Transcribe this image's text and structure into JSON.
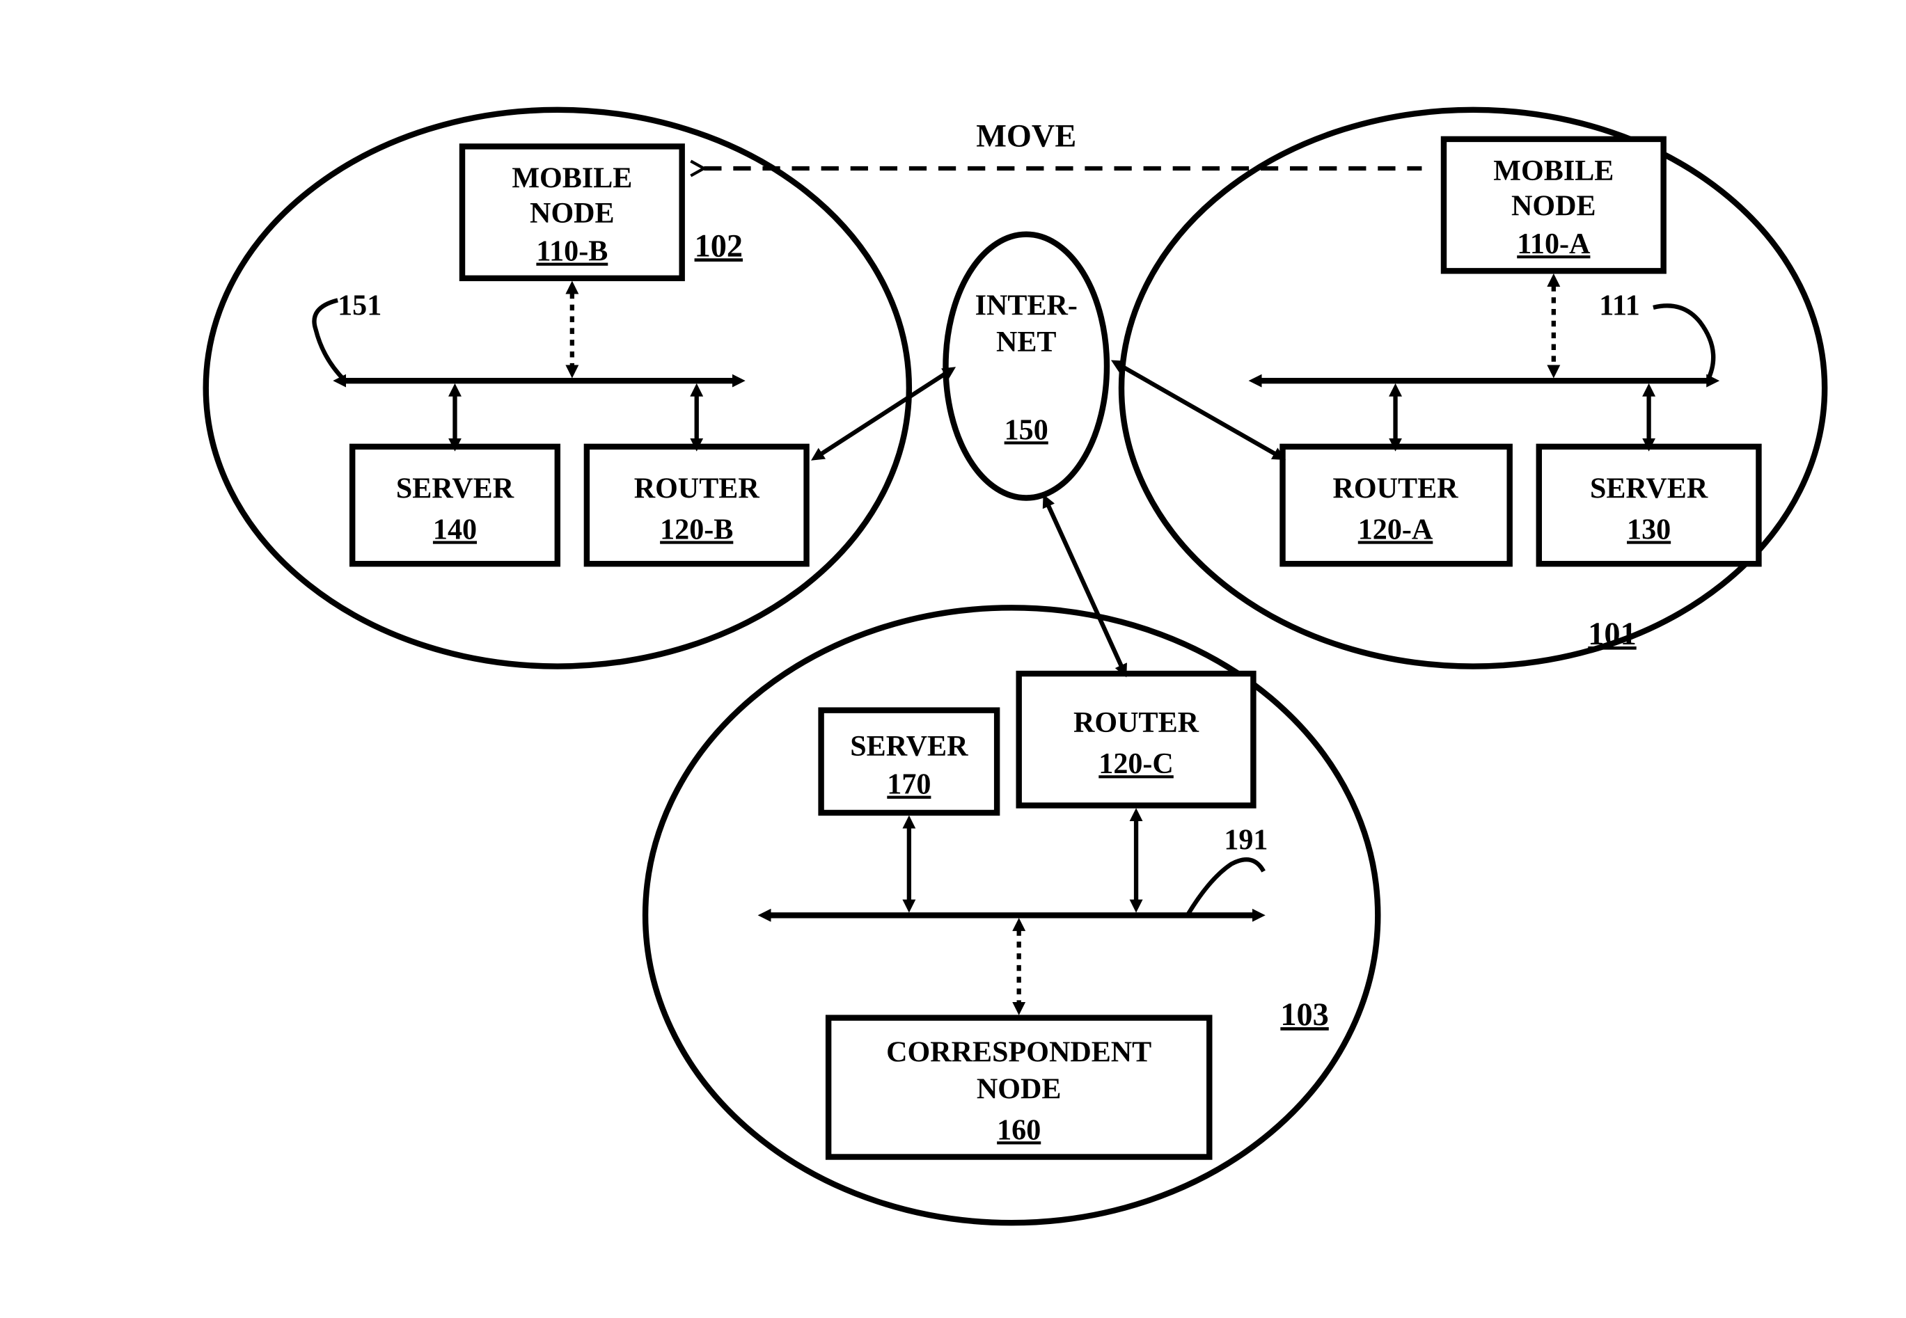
{
  "diagram": {
    "move_label": "MOVE",
    "internet": {
      "l1": "INTER-",
      "l2": "NET",
      "num": "150"
    },
    "network_a": {
      "zone_num": "101",
      "bus_num": "111",
      "mobile_node": {
        "l1": "MOBILE",
        "l2": "NODE",
        "num": "110-A"
      },
      "router": {
        "l1": "ROUTER",
        "num": "120-A"
      },
      "server": {
        "l1": "SERVER",
        "num": "130"
      }
    },
    "network_b": {
      "zone_num": "102",
      "bus_num": "151",
      "mobile_node": {
        "l1": "MOBILE",
        "l2": "NODE",
        "num": "110-B"
      },
      "router": {
        "l1": "ROUTER",
        "num": "120-B"
      },
      "server": {
        "l1": "SERVER",
        "num": "140"
      }
    },
    "network_c": {
      "zone_num": "103",
      "bus_num": "191",
      "router": {
        "l1": "ROUTER",
        "num": "120-C"
      },
      "server": {
        "l1": "SERVER",
        "num": "170"
      },
      "corr_node": {
        "l1": "CORRESPONDENT",
        "l2": "NODE",
        "num": "160"
      }
    }
  }
}
